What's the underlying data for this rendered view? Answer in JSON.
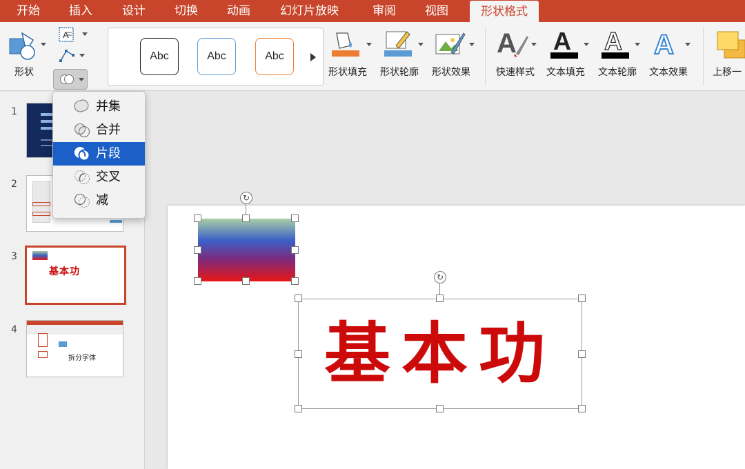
{
  "tabs": [
    "开始",
    "插入",
    "设计",
    "切换",
    "动画",
    "幻灯片放映",
    "审阅",
    "视图"
  ],
  "active_tab": "形状格式",
  "ribbon": {
    "shapes_label": "形状",
    "style_presets": [
      "Abc",
      "Abc",
      "Abc"
    ],
    "fill_label": "形状填充",
    "outline_label": "形状轮廓",
    "effects_label": "形状效果",
    "quick_styles_label": "快速样式",
    "text_fill_label": "文本填充",
    "text_outline_label": "文本轮廓",
    "text_effects_label": "文本效果",
    "bring_forward_label": "上移一",
    "accent_color": "#c8442a"
  },
  "merge_menu": {
    "items": [
      "并集",
      "合并",
      "片段",
      "交叉",
      "减"
    ],
    "selected": "片段",
    "selected_color": "#1b5fc9"
  },
  "slides": {
    "numbers": [
      "1",
      "2",
      "3",
      "4"
    ],
    "selected": "3",
    "thumb3_text": "基本功",
    "thumb4_text": "拆分字体"
  },
  "canvas": {
    "wordart_text": "基本功",
    "wordart_color": "#cc0a0a"
  }
}
